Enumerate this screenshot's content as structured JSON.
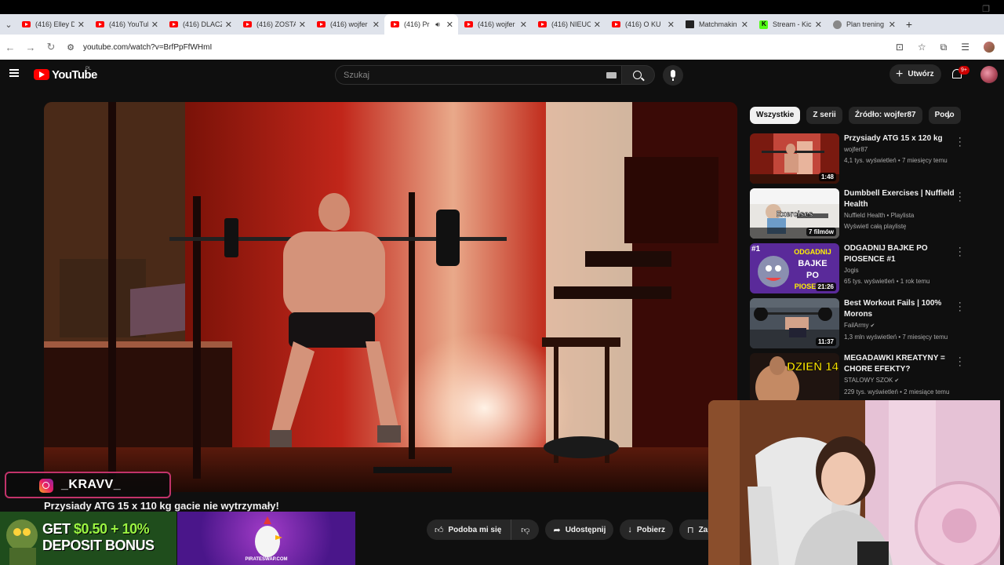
{
  "browser": {
    "tabs": [
      {
        "title": "(416) Elley D",
        "type": "yt"
      },
      {
        "title": "(416) YouTub",
        "type": "yt"
      },
      {
        "title": "(416) DLACZ",
        "type": "yt"
      },
      {
        "title": "(416) ZOSTA",
        "type": "yt"
      },
      {
        "title": "(416) wojfer",
        "type": "yt"
      },
      {
        "title": "(416) Pr",
        "type": "yt",
        "active": true
      },
      {
        "title": "(416) wojfer",
        "type": "yt"
      },
      {
        "title": "(416) NIEUC",
        "type": "yt"
      },
      {
        "title": "(416) O KU",
        "type": "yt"
      },
      {
        "title": "Matchmakin",
        "type": "mm"
      },
      {
        "title": "Stream - Kic",
        "type": "kick"
      },
      {
        "title": "Plan trening",
        "type": "plan"
      }
    ],
    "url": "youtube.com/watch?v=BrfPpFfWHmI"
  },
  "header": {
    "wordmark": "YouTube",
    "country": "PL",
    "search_placeholder": "Szukaj",
    "create_label": "Utwórz",
    "notifications": "9+"
  },
  "video": {
    "title": "Przysiady ATG 15 x 110 kg gacie nie wytrzymały!",
    "actions": {
      "like": "Podoba mi się",
      "share": "Udostępnij",
      "download": "Pobierz",
      "save": "Zapisz"
    }
  },
  "chips": [
    "Wszystkie",
    "Z serii",
    "Źródło: wojfer87",
    "Podo"
  ],
  "recommendations": [
    {
      "title": "Przysiady ATG 15 x 120 kg",
      "line1": "wojfer87",
      "line2": "4,1 tys. wyświetleń • 7 miesięcy temu",
      "duration": "1:48"
    },
    {
      "title": "Dumbbell Exercises | Nuffield Health",
      "line1": "Nuffield Health • Playlista",
      "line2": "Wyświetl całą playlistę",
      "duration": "7 filmów",
      "thumb_text": "Exercises"
    },
    {
      "title": "ODGADNIJ BAJKE PO PIOSENCE #1",
      "line1": "Jogis",
      "line2": "65 tys. wyświetleń • 1 rok temu",
      "duration": "21:26",
      "thumb_text": "ODGADNIJ BAJKE PO PIOSENCE",
      "thumb_num": "#1"
    },
    {
      "title": "Best Workout Fails | 100% Morons",
      "line1": "FailArmy",
      "line2": "1,3 mln wyświetleń • 7 miesięcy temu",
      "duration": "11:37",
      "verified": true
    },
    {
      "title": "MEGADAWKI KREATYNY = CHORE EFEKTY?",
      "line1": "STALOWY SZOK",
      "line2": "229 tys. wyświetleń • 2 miesiące temu",
      "thumb_text": "DZIEŃ 14",
      "verified": true
    }
  ],
  "overlay": {
    "instagram_handle": "_KRAVV_",
    "promo_line1_a": "GET ",
    "promo_line1_b": "$0.50 + 10%",
    "promo_line2": "DEPOSIT BONUS",
    "promo2_text": "PIRATESWAP.COM"
  }
}
